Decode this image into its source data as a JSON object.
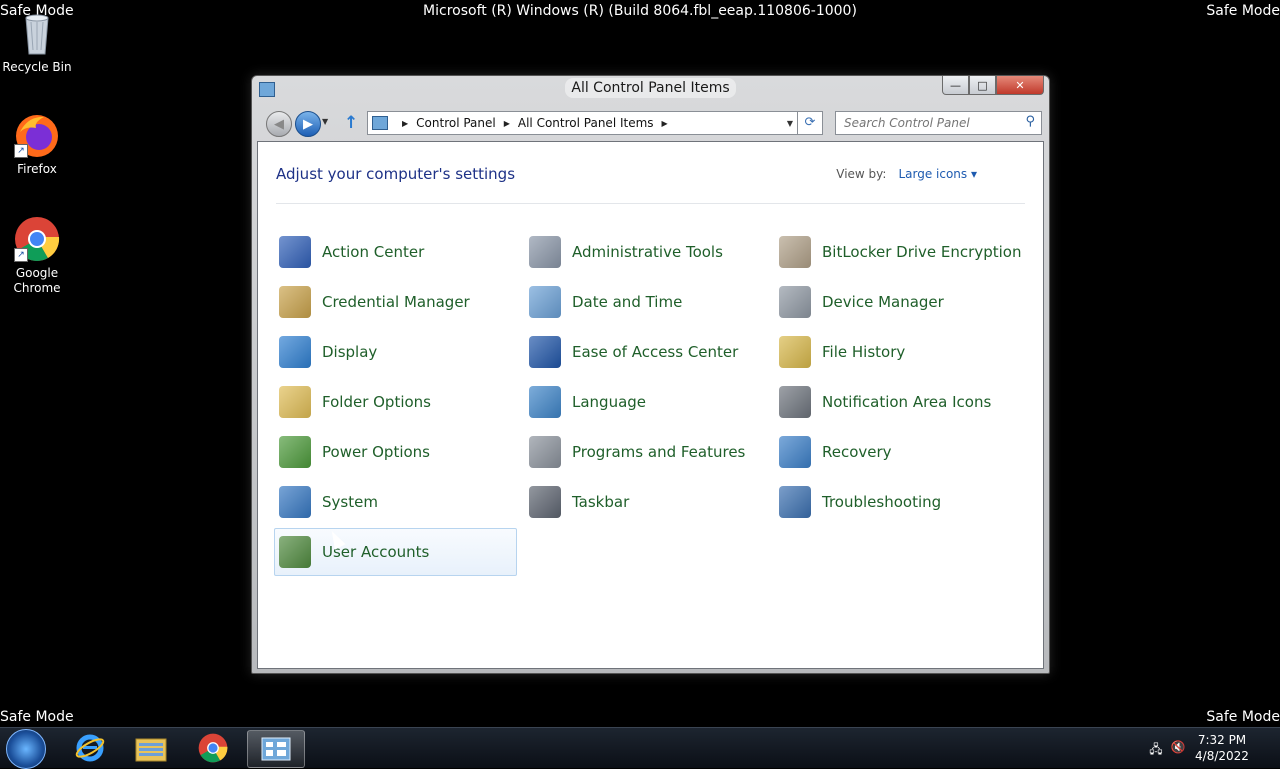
{
  "desktop": {
    "corner_labels": [
      "Safe Mode",
      "Safe Mode",
      "Safe Mode",
      "Safe Mode"
    ],
    "build_string": "Microsoft (R) Windows (R) (Build 8064.fbl_eeap.110806-1000)",
    "icons": [
      {
        "label": "Recycle Bin",
        "icon": "recycle-bin-icon"
      },
      {
        "label": "Firefox",
        "icon": "firefox-icon"
      },
      {
        "label": "Google Chrome",
        "icon": "chrome-icon"
      }
    ]
  },
  "window": {
    "title": "All Control Panel Items",
    "caption_buttons": {
      "minimize": "—",
      "maximize": "□",
      "close": "✕"
    },
    "address": {
      "crumbs": [
        "Control Panel",
        "All Control Panel Items"
      ]
    },
    "search": {
      "placeholder": "Search Control Panel"
    },
    "heading": "Adjust your computer's settings",
    "view_by": {
      "label": "View by:",
      "value": "Large icons ▾"
    },
    "items": [
      {
        "label": "Action Center",
        "icon": "flag-icon",
        "color": "#2f5fb8"
      },
      {
        "label": "Administrative Tools",
        "icon": "gears-icon",
        "color": "#8a96a8"
      },
      {
        "label": "BitLocker Drive Encryption",
        "icon": "keys-icon",
        "color": "#b0a088"
      },
      {
        "label": "Credential Manager",
        "icon": "vault-icon",
        "color": "#c9a24a"
      },
      {
        "label": "Date and Time",
        "icon": "calendar-clock-icon",
        "color": "#6aa0d6"
      },
      {
        "label": "Device Manager",
        "icon": "device-icon",
        "color": "#8f98a3"
      },
      {
        "label": "Display",
        "icon": "monitor-icon",
        "color": "#2e7fd1"
      },
      {
        "label": "Ease of Access Center",
        "icon": "accessibility-icon",
        "color": "#1f55a8"
      },
      {
        "label": "File History",
        "icon": "folder-clock-icon",
        "color": "#d8b84a"
      },
      {
        "label": "Folder Options",
        "icon": "folder-check-icon",
        "color": "#e0bd55"
      },
      {
        "label": "Language",
        "icon": "globe-people-icon",
        "color": "#3d84c8"
      },
      {
        "label": "Notification Area Icons",
        "icon": "tray-icon",
        "color": "#6d737c"
      },
      {
        "label": "Power Options",
        "icon": "battery-icon",
        "color": "#4c9a3a"
      },
      {
        "label": "Programs and Features",
        "icon": "programs-icon",
        "color": "#8a919b"
      },
      {
        "label": "Recovery",
        "icon": "recovery-icon",
        "color": "#3b7fc8"
      },
      {
        "label": "System",
        "icon": "computer-icon",
        "color": "#3577c2"
      },
      {
        "label": "Taskbar",
        "icon": "taskbar-icon",
        "color": "#5d6470"
      },
      {
        "label": "Troubleshooting",
        "icon": "troubleshoot-icon",
        "color": "#3a6fb0"
      },
      {
        "label": "User Accounts",
        "icon": "users-icon",
        "color": "#4f8a3e"
      }
    ]
  },
  "taskbar": {
    "apps": [
      "internet-explorer-icon",
      "file-explorer-icon",
      "chrome-icon",
      "control-panel-icon"
    ],
    "time": "7:32 PM",
    "date": "4/8/2022"
  }
}
